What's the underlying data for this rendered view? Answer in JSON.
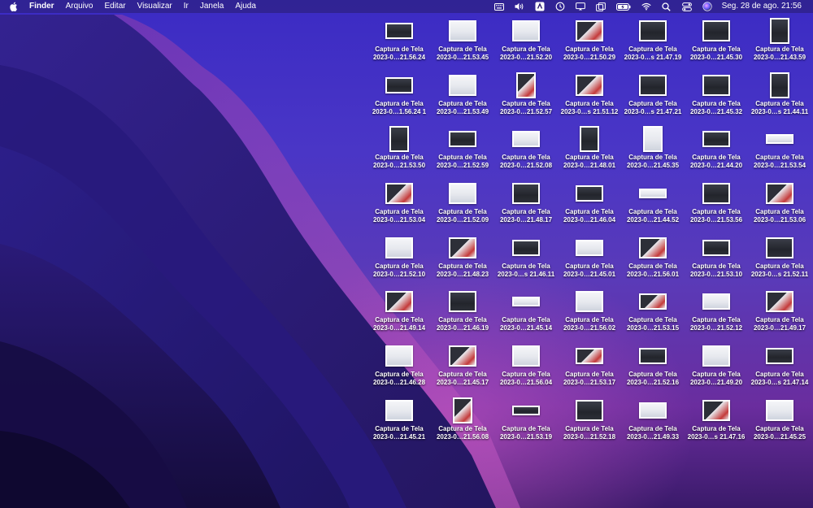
{
  "menubar": {
    "app": "Finder",
    "menus": [
      "Arquivo",
      "Editar",
      "Visualizar",
      "Ir",
      "Janela",
      "Ajuda"
    ],
    "status_icons": [
      "keyboard-icon",
      "volume-icon",
      "creative-cloud-icon",
      "time-machine-icon",
      "screen-mirroring-icon",
      "window-icon",
      "battery-charging-icon",
      "wifi-icon",
      "spotlight-search-icon",
      "control-center-icon",
      "siri-icon"
    ],
    "clock": "Seg. 28 de ago.  21:56"
  },
  "desktop": {
    "files": [
      {
        "title": "Captura de Tela",
        "stamp": "2023-0…21.56.24",
        "shape": "wide",
        "theme": "dark"
      },
      {
        "title": "Captura de Tela",
        "stamp": "2023-0…21.53.45",
        "shape": "medium",
        "theme": "light"
      },
      {
        "title": "Captura de Tela",
        "stamp": "2023-0…21.52.20",
        "shape": "medium",
        "theme": "light"
      },
      {
        "title": "Captura de Tela",
        "stamp": "2023-0…21.50.29",
        "shape": "medium",
        "theme": "mixed"
      },
      {
        "title": "Captura de Tela",
        "stamp": "2023-0…s 21.47.19",
        "shape": "medium",
        "theme": "dark"
      },
      {
        "title": "Captura de Tela",
        "stamp": "2023-0…21.45.30",
        "shape": "medium",
        "theme": "dark"
      },
      {
        "title": "Captura de Tela",
        "stamp": "2023-0…21.43.59",
        "shape": "tall",
        "theme": "dark"
      },
      {
        "title": "Captura de Tela",
        "stamp": "2023-0…1.56.24 1",
        "shape": "wide",
        "theme": "dark"
      },
      {
        "title": "Captura de Tela",
        "stamp": "2023-0…21.53.49",
        "shape": "medium",
        "theme": "light"
      },
      {
        "title": "Captura de Tela",
        "stamp": "2023-0…21.52.57",
        "shape": "tall",
        "theme": "mixed"
      },
      {
        "title": "Captura de Tela",
        "stamp": "2023-0…s 21.51.12",
        "shape": "medium",
        "theme": "mixed"
      },
      {
        "title": "Captura de Tela",
        "stamp": "2023-0…s 21.47.21",
        "shape": "medium",
        "theme": "dark"
      },
      {
        "title": "Captura de Tela",
        "stamp": "2023-0…21.45.32",
        "shape": "medium",
        "theme": "dark"
      },
      {
        "title": "Captura de Tela",
        "stamp": "2023-0…s 21.44.11",
        "shape": "tall",
        "theme": "dark"
      },
      {
        "title": "Captura de Tela",
        "stamp": "2023-0…21.53.50",
        "shape": "tall",
        "theme": "dark"
      },
      {
        "title": "Captura de Tela",
        "stamp": "2023-0…21.52.59",
        "shape": "wide",
        "theme": "dark"
      },
      {
        "title": "Captura de Tela",
        "stamp": "2023-0…21.52.08",
        "shape": "wide",
        "theme": "light"
      },
      {
        "title": "Captura de Tela",
        "stamp": "2023-0…21.48.01",
        "shape": "tall",
        "theme": "dark"
      },
      {
        "title": "Captura de Tela",
        "stamp": "2023-0…21.45.35",
        "shape": "tall",
        "theme": "light"
      },
      {
        "title": "Captura de Tela",
        "stamp": "2023-0…21.44.20",
        "shape": "wide",
        "theme": "dark"
      },
      {
        "title": "Captura de Tela",
        "stamp": "2023-0…21.53.54",
        "shape": "flat",
        "theme": "light"
      },
      {
        "title": "Captura de Tela",
        "stamp": "2023-0…21.53.04",
        "shape": "medium",
        "theme": "mixed"
      },
      {
        "title": "Captura de Tela",
        "stamp": "2023-0…21.52.09",
        "shape": "medium",
        "theme": "light"
      },
      {
        "title": "Captura de Tela",
        "stamp": "2023-0…21.48.17",
        "shape": "medium",
        "theme": "dark"
      },
      {
        "title": "Captura de Tela",
        "stamp": "2023-0…21.46.04",
        "shape": "wide",
        "theme": "dark"
      },
      {
        "title": "Captura de Tela",
        "stamp": "2023-0…21.44.52",
        "shape": "flat",
        "theme": "light"
      },
      {
        "title": "Captura de Tela",
        "stamp": "2023-0…21.53.56",
        "shape": "medium",
        "theme": "dark"
      },
      {
        "title": "Captura de Tela",
        "stamp": "2023-0…21.53.06",
        "shape": "medium",
        "theme": "mixed"
      },
      {
        "title": "Captura de Tela",
        "stamp": "2023-0…21.52.10",
        "shape": "medium",
        "theme": "light"
      },
      {
        "title": "Captura de Tela",
        "stamp": "2023-0…21.48.23",
        "shape": "medium",
        "theme": "mixed"
      },
      {
        "title": "Captura de Tela",
        "stamp": "2023-0…s 21.46.11",
        "shape": "wide",
        "theme": "dark"
      },
      {
        "title": "Captura de Tela",
        "stamp": "2023-0…21.45.01",
        "shape": "wide",
        "theme": "light"
      },
      {
        "title": "Captura de Tela",
        "stamp": "2023-0…21.56.01",
        "shape": "medium",
        "theme": "mixed"
      },
      {
        "title": "Captura de Tela",
        "stamp": "2023-0…21.53.10",
        "shape": "wide",
        "theme": "dark"
      },
      {
        "title": "Captura de Tela",
        "stamp": "2023-0…s 21.52.11",
        "shape": "medium",
        "theme": "dark"
      },
      {
        "title": "Captura de Tela",
        "stamp": "2023-0…21.49.14",
        "shape": "medium",
        "theme": "mixed"
      },
      {
        "title": "Captura de Tela",
        "stamp": "2023-0…21.46.19",
        "shape": "medium",
        "theme": "dark"
      },
      {
        "title": "Captura de Tela",
        "stamp": "2023-0…21.45.14",
        "shape": "flat",
        "theme": "light"
      },
      {
        "title": "Captura de Tela",
        "stamp": "2023-0…21.56.02",
        "shape": "medium",
        "theme": "light"
      },
      {
        "title": "Captura de Tela",
        "stamp": "2023-0…21.53.15",
        "shape": "wide",
        "theme": "mixed"
      },
      {
        "title": "Captura de Tela",
        "stamp": "2023-0…21.52.12",
        "shape": "wide",
        "theme": "light"
      },
      {
        "title": "Captura de Tela",
        "stamp": "2023-0…21.49.17",
        "shape": "medium",
        "theme": "mixed"
      },
      {
        "title": "Captura de Tela",
        "stamp": "2023-0…21.46.28",
        "shape": "medium",
        "theme": "light"
      },
      {
        "title": "Captura de Tela",
        "stamp": "2023-0…21.45.17",
        "shape": "medium",
        "theme": "mixed"
      },
      {
        "title": "Captura de Tela",
        "stamp": "2023-0…21.56.04",
        "shape": "medium",
        "theme": "light"
      },
      {
        "title": "Captura de Tela",
        "stamp": "2023-0…21.53.17",
        "shape": "wide",
        "theme": "mixed"
      },
      {
        "title": "Captura de Tela",
        "stamp": "2023-0…21.52.16",
        "shape": "wide",
        "theme": "dark"
      },
      {
        "title": "Captura de Tela",
        "stamp": "2023-0…21.49.20",
        "shape": "medium",
        "theme": "light"
      },
      {
        "title": "Captura de Tela",
        "stamp": "2023-0…s 21.47.14",
        "shape": "wide",
        "theme": "dark"
      },
      {
        "title": "Captura de Tela",
        "stamp": "2023-0…21.45.21",
        "shape": "medium",
        "theme": "light"
      },
      {
        "title": "Captura de Tela",
        "stamp": "2023-0…21.56.08",
        "shape": "tall",
        "theme": "mixed"
      },
      {
        "title": "Captura de Tela",
        "stamp": "2023-0…21.53.19",
        "shape": "flat",
        "theme": "dark"
      },
      {
        "title": "Captura de Tela",
        "stamp": "2023-0…21.52.18",
        "shape": "medium",
        "theme": "dark"
      },
      {
        "title": "Captura de Tela",
        "stamp": "2023-0…21.49.33",
        "shape": "wide",
        "theme": "light"
      },
      {
        "title": "Captura de Tela",
        "stamp": "2023-0…s 21.47.16",
        "shape": "medium",
        "theme": "mixed"
      },
      {
        "title": "Captura de Tela",
        "stamp": "2023-0…21.45.25",
        "shape": "medium",
        "theme": "light"
      }
    ]
  }
}
